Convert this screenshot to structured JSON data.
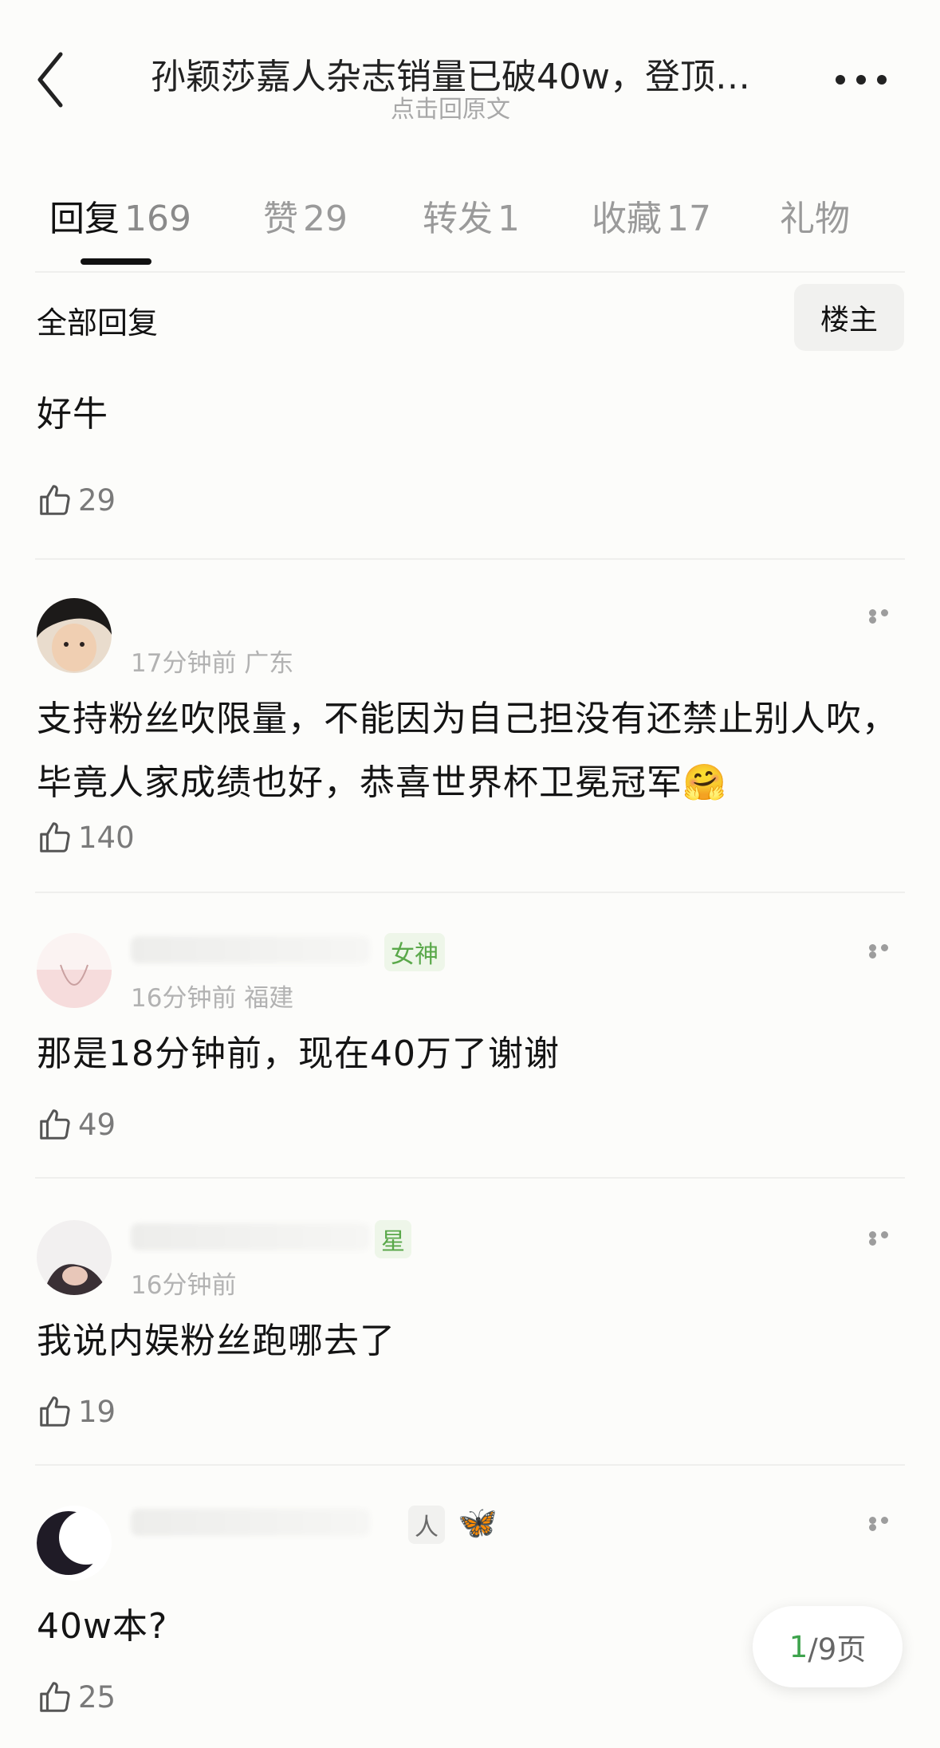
{
  "header": {
    "title": "孙颖莎嘉人杂志销量已破40w，登顶…",
    "subtitle": "点击回原文"
  },
  "tabs": [
    {
      "label": "回复",
      "count": "169",
      "active": true
    },
    {
      "label": "赞",
      "count": "29",
      "active": false
    },
    {
      "label": "转发",
      "count": "1",
      "active": false
    },
    {
      "label": "收藏",
      "count": "17",
      "active": false
    },
    {
      "label": "礼物",
      "count": "",
      "active": false
    }
  ],
  "filter": {
    "label": "全部回复",
    "op_button": "楼主"
  },
  "comments": [
    {
      "time_location": "",
      "badge": "",
      "text": "好牛",
      "likes": "29"
    },
    {
      "time_location": "17分钟前 广东",
      "badge": "",
      "text": "支持粉丝吹限量，不能因为自己担没有还禁止别人吹，毕竟人家成绩也好，恭喜世界杯卫冕冠军🤗",
      "likes": "140"
    },
    {
      "time_location": "16分钟前 福建",
      "badge": "女神",
      "text": "那是18分钟前，现在40万了谢谢",
      "likes": "49"
    },
    {
      "time_location": "16分钟前",
      "badge": "星",
      "text": "我说内娱粉丝跑哪去了",
      "likes": "19"
    },
    {
      "time_location": "",
      "badge": "人",
      "badge_emoji": "🦋",
      "text": "40w本?",
      "likes": "25"
    }
  ],
  "pager": {
    "current": "1",
    "total_text": "/9页"
  },
  "colors": {
    "accent_green": "#3ea34d",
    "badge_green": "#5aa84a",
    "muted": "#9a9a9a"
  },
  "icons": [
    "back-chevron-icon",
    "more-dots-icon",
    "thumbs-up-icon"
  ]
}
